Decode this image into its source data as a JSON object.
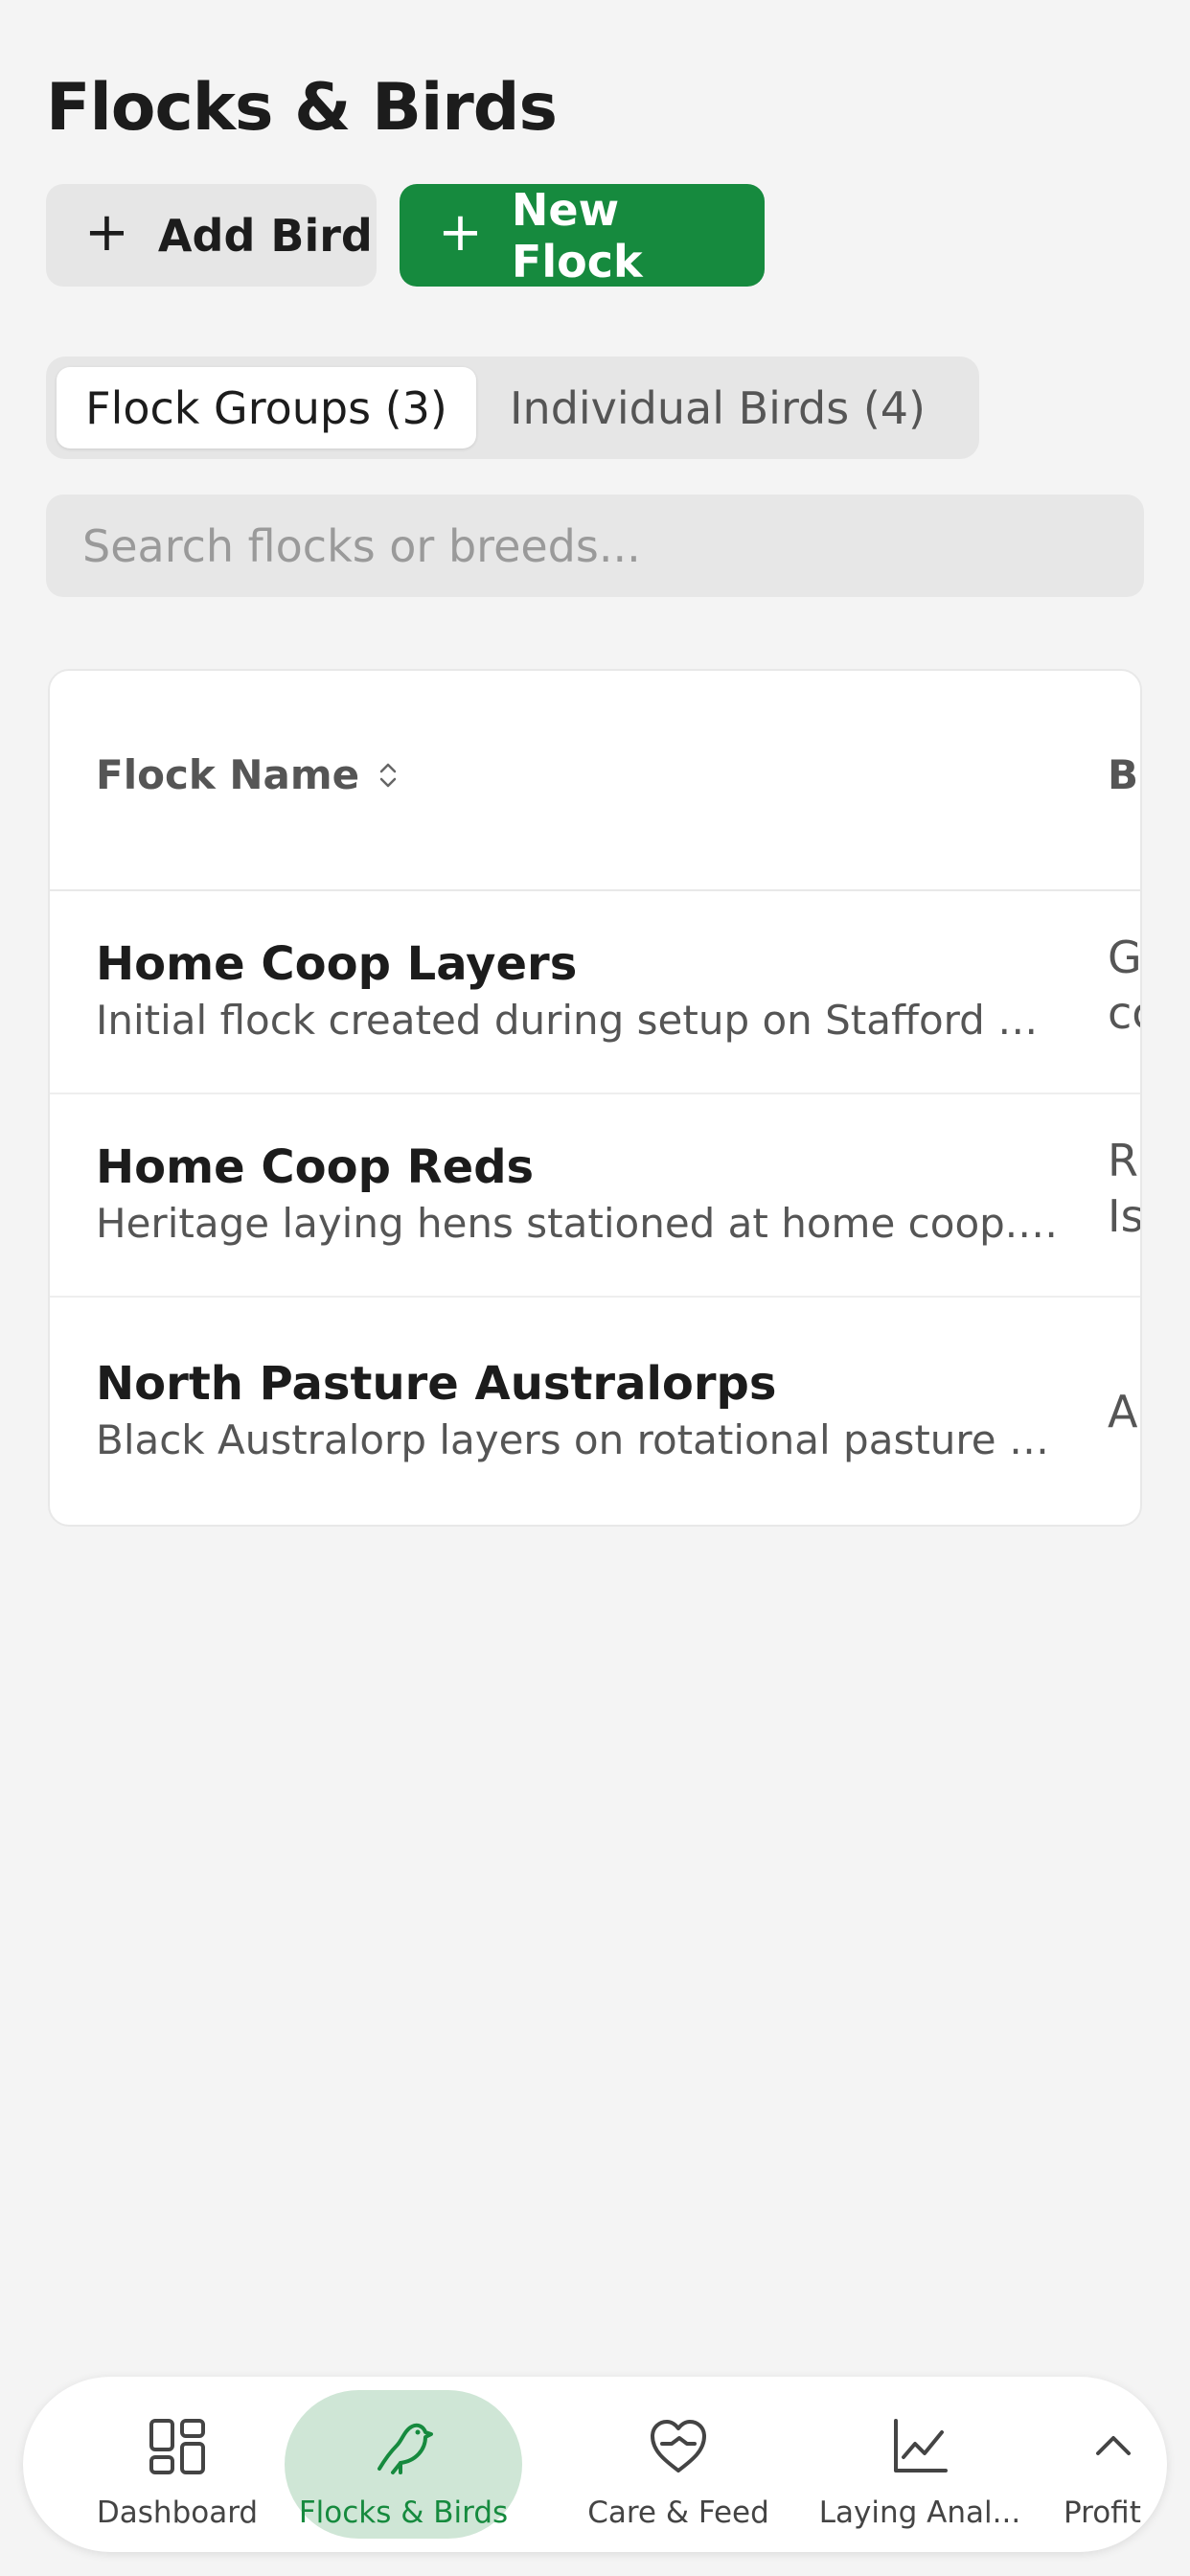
{
  "header": {
    "title": "Flocks & Birds"
  },
  "actions": {
    "add_bird_label": "Add Bird",
    "new_flock_label": "New Flock"
  },
  "tabs": [
    {
      "label": "Flock Groups (3)",
      "active": true
    },
    {
      "label": "Individual Birds (4)",
      "active": false
    }
  ],
  "search": {
    "placeholder": "Search flocks or breeds...",
    "value": ""
  },
  "table": {
    "columns": [
      "Flock Name",
      "Br"
    ],
    "rows": [
      {
        "name": "Home Coop Layers",
        "description": "Initial flock created during setup on Stafford Hi...",
        "breed": "G\ncc"
      },
      {
        "name": "Home Coop Reds",
        "description": "Heritage laying hens stationed at home coop. ...",
        "breed": "Rl\nIs"
      },
      {
        "name": "North Pasture Australorps",
        "description": "Black Australorp layers on rotational pasture w...",
        "breed": "Au"
      }
    ]
  },
  "bottom_nav": {
    "items": [
      {
        "label": "Dashboard",
        "icon": "dashboard-grid-icon",
        "active": false
      },
      {
        "label": "Flocks & Birds",
        "icon": "bird-icon",
        "active": true
      },
      {
        "label": "Care & Feed",
        "icon": "heart-hand-icon",
        "active": false
      },
      {
        "label": "Laying Anal...",
        "icon": "line-chart-icon",
        "active": false
      },
      {
        "label": "Profit",
        "icon": "chevron-up-icon",
        "active": false
      }
    ]
  },
  "colors": {
    "accent": "#168a3e",
    "accent_light": "#cfe6d6",
    "background": "#f4f4f4"
  }
}
